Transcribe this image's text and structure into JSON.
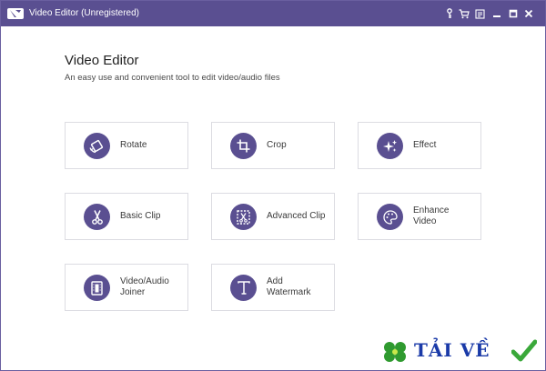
{
  "window": {
    "title": "Video Editor (Unregistered)",
    "accent_color": "#5a4f91",
    "buttons": [
      {
        "name": "register-key-button",
        "icon": "key-icon"
      },
      {
        "name": "cart-button",
        "icon": "cart-icon"
      },
      {
        "name": "feedback-button",
        "icon": "feedback-icon"
      },
      {
        "name": "minimize-button",
        "icon": "minimize-icon"
      },
      {
        "name": "maximize-button",
        "icon": "maximize-icon"
      },
      {
        "name": "close-button",
        "icon": "close-icon"
      }
    ]
  },
  "main": {
    "title": "Video Editor",
    "subtitle": "An easy use and convenient tool to edit video/audio files",
    "tools": [
      {
        "label": "Rotate",
        "icon": "rotate-icon"
      },
      {
        "label": "Crop",
        "icon": "crop-icon"
      },
      {
        "label": "Effect",
        "icon": "sparkle-icon"
      },
      {
        "label": "Basic Clip",
        "icon": "scissors-icon"
      },
      {
        "label": "Advanced Clip",
        "icon": "advanced-clip-icon"
      },
      {
        "label": "Enhance\nVideo",
        "icon": "palette-icon"
      },
      {
        "label": "Video/Audio\nJoiner",
        "icon": "film-joiner-icon"
      },
      {
        "label": "Add\nWatermark",
        "icon": "text-t-icon"
      }
    ]
  },
  "watermark": {
    "text": "TẢI VỀ",
    "icon": "clover-icon",
    "check_icon": "checkmark-icon"
  }
}
